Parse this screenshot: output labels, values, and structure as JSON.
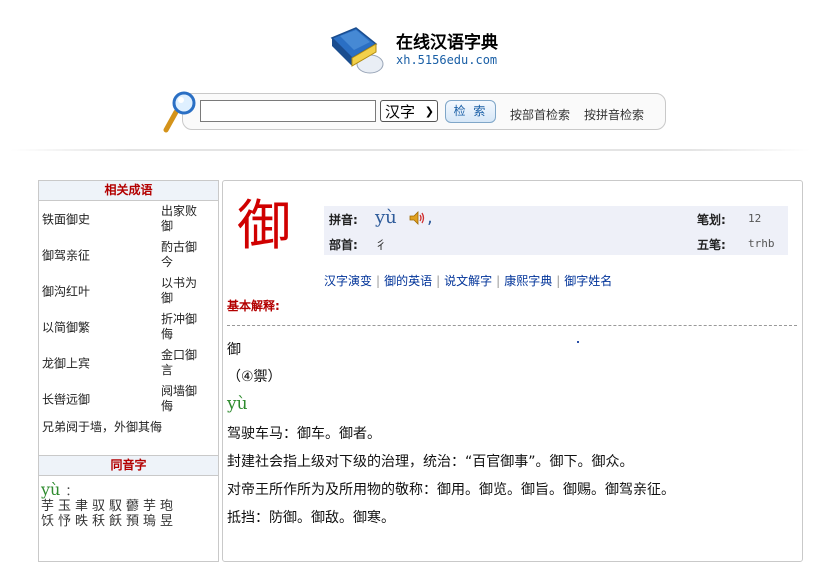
{
  "header": {
    "site_title": "在线汉语字典",
    "site_url": "xh.5156edu.com"
  },
  "search": {
    "input_value": "",
    "select_value": "汉字",
    "button_label": "检 索",
    "radical_link": "按部首检索",
    "pinyin_link": "按拼音检索"
  },
  "sidebar": {
    "idioms_title": "相关成语",
    "idioms": [
      {
        "left": "铁面御史",
        "right": "出家败御"
      },
      {
        "left": "御驾亲征",
        "right": "酌古御今"
      },
      {
        "left": "御沟红叶",
        "right": "以书为御"
      },
      {
        "left": "以简御繁",
        "right": "折冲御侮"
      },
      {
        "left": "龙御上宾",
        "right": "金口御言"
      },
      {
        "left": "长辔远御",
        "right": "阋墙御侮"
      }
    ],
    "idiom_last": "兄弟阋于墙，外御其侮",
    "homophones_title": "同音字",
    "homophone_pinyin": "yù",
    "homophone_colon": "：",
    "homophone_chars_line1": "芋玉聿驭馭䖇芋玸",
    "homophone_chars_line2": "饫忬昳秗飫預瑦昱"
  },
  "main": {
    "character": "御",
    "pinyin_label": "拼音:",
    "pinyin_value": "yù",
    "pinyin_comma": ",",
    "radical_label": "部首:",
    "radical_value": "彳",
    "strokes_label": "笔划:",
    "strokes_value": "12",
    "wubi_label": "五笔:",
    "wubi_value": "trhb",
    "links": [
      "汉字演变",
      "御的英语",
      "说文解字",
      "康熙字典",
      "御字姓名"
    ],
    "basic_label": "基本解释:",
    "def_char": "御",
    "def_variant": "（④禦）",
    "def_pinyin": "yù",
    "definitions": [
      "驾驶车马：御车。御者。",
      "封建社会指上级对下级的治理，统治：“百官御事”。御下。御众。",
      "对帝王所作所为及所用物的敬称：御用。御览。御旨。御赐。御驾亲征。",
      "抵挡：防御。御敌。御寒。"
    ]
  },
  "colors": {
    "accent_red": "#d00000",
    "label_red": "#b30000",
    "link_blue": "#003399",
    "pinyin_green": "#2e8b2e",
    "panel_bg": "#eef0f8"
  }
}
